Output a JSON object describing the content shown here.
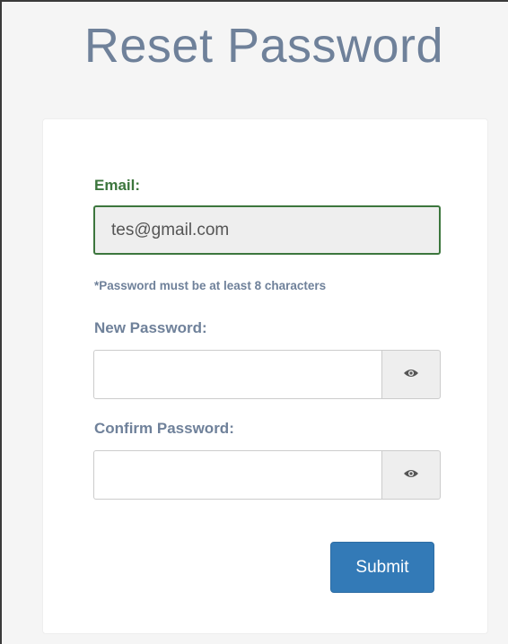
{
  "page": {
    "title": "Reset Password"
  },
  "form": {
    "email_label": "Email:",
    "email_value": "tes@gmail.com",
    "password_hint": "*Password must be at least 8 characters",
    "new_password_label": "New Password:",
    "new_password_value": "",
    "confirm_password_label": "Confirm Password:",
    "confirm_password_value": "",
    "submit_label": "Submit",
    "toggle_icon": "eye-icon"
  },
  "colors": {
    "title": "#6f819a",
    "success_label": "#3c763d",
    "primary_button": "#337ab7",
    "input_disabled_bg": "#eeeeee"
  }
}
